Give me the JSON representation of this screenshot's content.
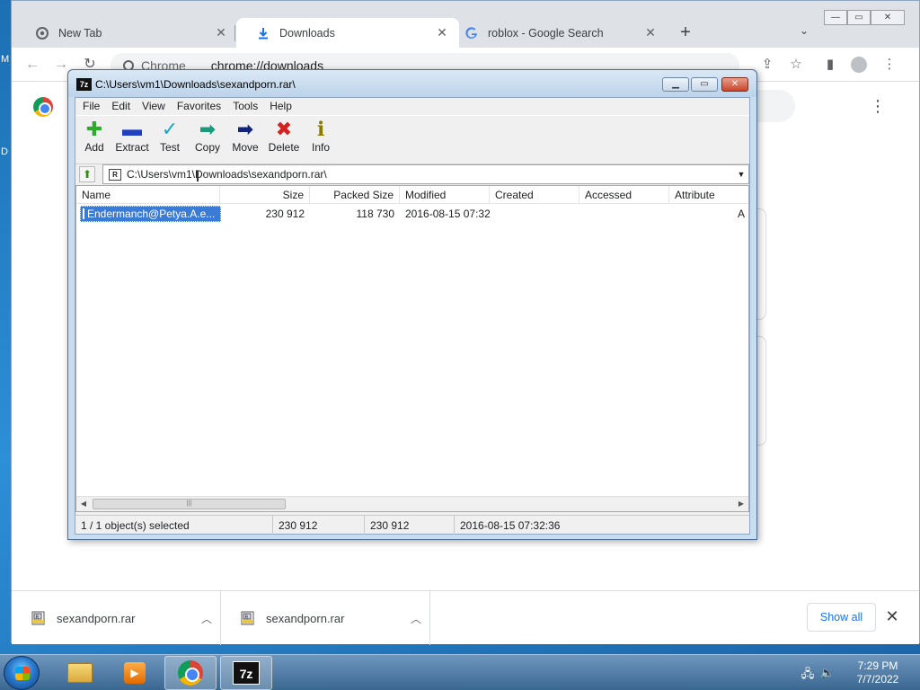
{
  "desktop": {
    "side_chars": [
      "M",
      "D"
    ]
  },
  "chrome": {
    "tabs": [
      {
        "title": "New Tab",
        "icon": "chrome-icon"
      },
      {
        "title": "Downloads",
        "icon": "download-icon"
      },
      {
        "title": "roblox - Google Search",
        "icon": "google-icon"
      }
    ],
    "newtab_label": "+",
    "tab_search_label": "⌄",
    "window_controls": {
      "min": "—",
      "max": "▭",
      "close": "✕"
    },
    "omnibox": {
      "origin_label": "Chrome",
      "url": "chrome://downloads"
    },
    "shelf": {
      "items": [
        {
          "name": "sexandporn.rar",
          "icon": "rar-file-icon"
        },
        {
          "name": "sexandporn.rar",
          "icon": "rar-file-icon"
        }
      ],
      "show_all": "Show all",
      "close": "✕"
    },
    "page_menu": "⋮"
  },
  "sevenzip": {
    "title": "C:\\Users\\vm1\\Downloads\\sexandporn.rar\\",
    "app_icon": "7z",
    "menu": [
      "File",
      "Edit",
      "View",
      "Favorites",
      "Tools",
      "Help"
    ],
    "toolbar": [
      {
        "label": "Add",
        "icon": "plus-icon",
        "color": "#2faa2f"
      },
      {
        "label": "Extract",
        "icon": "minus-icon",
        "color": "#1f3fbf"
      },
      {
        "label": "Test",
        "icon": "check-icon",
        "color": "#1aa6c8"
      },
      {
        "label": "Copy",
        "icon": "copy-arrow-icon",
        "color": "#1a9a7a"
      },
      {
        "label": "Move",
        "icon": "move-arrow-icon",
        "color": "#13237a"
      },
      {
        "label": "Delete",
        "icon": "x-icon",
        "color": "#d42020"
      },
      {
        "label": "Info",
        "icon": "info-icon",
        "color": "#d8c400"
      }
    ],
    "address": "C:\\Users\\vm1\\Downloads\\sexandporn.rar\\",
    "columns": [
      "Name",
      "Size",
      "Packed Size",
      "Modified",
      "Created",
      "Accessed",
      "Attribute"
    ],
    "rows": [
      {
        "name": "Endermanch@Petya.A.e...",
        "size": "230 912",
        "packed": "118 730",
        "modified": "2016-08-15 07:32",
        "created": "",
        "accessed": "",
        "attr": "A"
      }
    ],
    "status": {
      "selected": "1 / 1 object(s) selected",
      "size": "230 912",
      "packed": "230 912",
      "modified": "2016-08-15 07:32:36"
    }
  },
  "taskbar": {
    "apps": [
      "explorer",
      "media-player",
      "chrome",
      "7-zip"
    ],
    "clock": {
      "time": "7:29 PM",
      "date": "7/7/2022"
    }
  }
}
